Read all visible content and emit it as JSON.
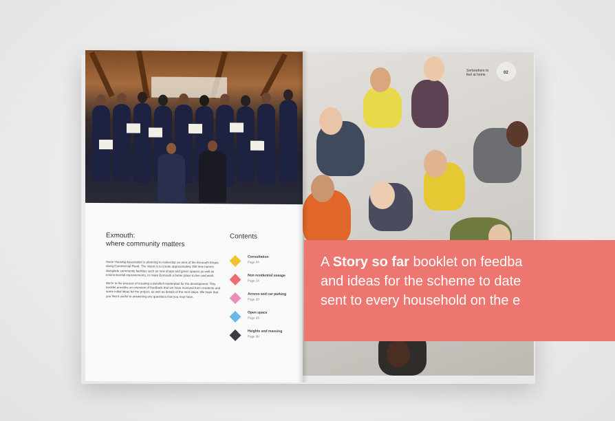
{
  "left_page": {
    "title_line1": "Exmouth:",
    "title_line2": "where community matters",
    "intro_p1": "Swan Housing Association is planning to redevelop an area of the Exmouth Estate along Commercial Road. The vision is to create approximately 250 new homes alongside community facilities such as new shops and green spaces as well as environmental improvements, to make Exmouth a better place to live and work.",
    "intro_p2": "We're in the process of creating a detailed masterplan for the development. This booklet provides an overview of feedback that we have received from residents and some initial ideas for the project, as well as details of the next steps. We hope that you find it useful in answering any questions that you may have.",
    "contents_heading": "Contents",
    "contents": [
      {
        "label": "Consultation",
        "page": "Page 04",
        "color": "#f2c230"
      },
      {
        "label": "Non residential useage",
        "page": "Page 14",
        "color": "#ec6e73"
      },
      {
        "label": "Access and car parking",
        "page": "Page 20",
        "color": "#ea8fb8"
      },
      {
        "label": "Open space",
        "page": "Page 26",
        "color": "#6ab8e4"
      },
      {
        "label": "Heights and massing",
        "page": "Page 38",
        "color": "#3a3d44"
      }
    ]
  },
  "right_page": {
    "tag_line1": "Somewhere to",
    "tag_line2": "feel at home",
    "tag_number": "02"
  },
  "callout": {
    "part1": "A ",
    "bold": "Story so far",
    "part2": " booklet on feedba",
    "line2": "and ideas for the scheme to date",
    "line3": "sent to every household on the e"
  }
}
